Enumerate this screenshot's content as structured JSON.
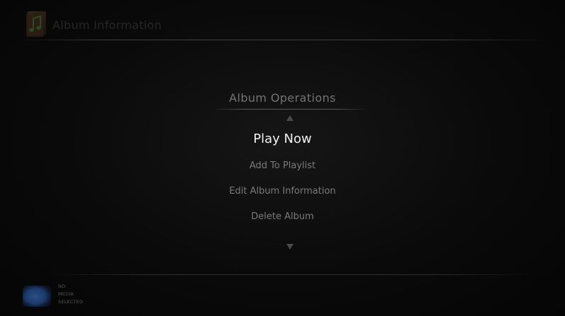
{
  "header": {
    "title": "Album Information",
    "icon": "music-note-icon"
  },
  "menu": {
    "heading": "Album Operations",
    "scroll_up_icon": "chevron-up-icon",
    "scroll_down_icon": "chevron-down-icon",
    "items": [
      {
        "label": "Play Now",
        "selected": true
      },
      {
        "label": "Add To Playlist",
        "selected": false
      },
      {
        "label": "Edit Album Information",
        "selected": false
      },
      {
        "label": "Delete Album",
        "selected": false
      }
    ]
  },
  "footer": {
    "thumbnail_icon": "media-thumbnail-icon",
    "status_lines": [
      "NO",
      "MEDIA",
      "SELECTED"
    ]
  },
  "colors": {
    "background": "#0a0a0a",
    "selected_text": "#f2f2f2",
    "menu_text": "#7a7a7a",
    "header_text": "#262626",
    "thumbnail_blue": "#1c3a6a"
  }
}
